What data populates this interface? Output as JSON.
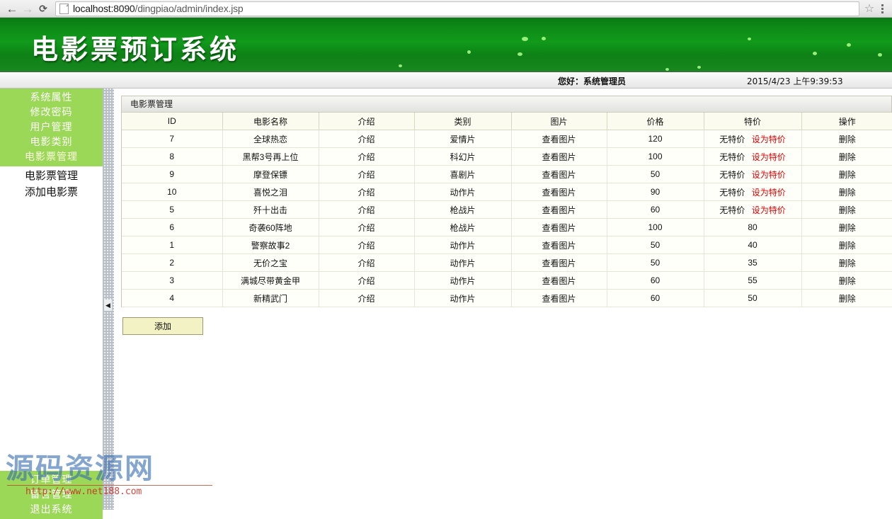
{
  "browser": {
    "back_icon": "back-arrow-icon",
    "forward_icon": "forward-arrow-icon",
    "reload_icon": "reload-icon",
    "url_scheme_host": "localhost:8090",
    "url_path": "/dingpiao/admin/index.jsp",
    "url_full": "localhost:8090/dingpiao/admin/index.jsp",
    "star_glyph": "☆",
    "star_icon": "bookmark-star-icon",
    "menu_icon": "overflow-menu-icon"
  },
  "banner": {
    "title": "电影票预订系统",
    "bg_color": "#0f9419"
  },
  "status": {
    "greeting": "您好：系统管理员",
    "datetime": "2015/4/23 上午9:39:53"
  },
  "sidebar": {
    "group_top": [
      {
        "label": "系统属性"
      },
      {
        "label": "修改密码"
      },
      {
        "label": "用户管理"
      },
      {
        "label": "电影类别"
      },
      {
        "label": "电影票管理"
      }
    ],
    "submenu": [
      {
        "label": "电影票管理"
      },
      {
        "label": "添加电影票"
      }
    ],
    "group_bottom": [
      {
        "label": "订单管理"
      },
      {
        "label": "留言管理"
      },
      {
        "label": "退出系统"
      }
    ],
    "accent_color": "#9cd858",
    "collapse_glyph": "◀"
  },
  "panel": {
    "title": "电影票管理",
    "add_button": "添加"
  },
  "table": {
    "columns": [
      "ID",
      "电影名称",
      "介绍",
      "类别",
      "图片",
      "价格",
      "特价",
      "操作"
    ],
    "intro_label": "介绍",
    "image_label": "查看图片",
    "no_special_label": "无特价",
    "set_special_label": "设为特价",
    "delete_label": "删除",
    "special_link_color": "#e20000",
    "rows": [
      {
        "id": "7",
        "name": "全球热恋",
        "intro": "介绍",
        "category": "爱情片",
        "image": "查看图片",
        "price": "120",
        "special": "无特价",
        "has_special": false,
        "action": "删除"
      },
      {
        "id": "8",
        "name": "黑帮3号再上位",
        "intro": "介绍",
        "category": "科幻片",
        "image": "查看图片",
        "price": "100",
        "special": "无特价",
        "has_special": false,
        "action": "删除"
      },
      {
        "id": "9",
        "name": "摩登保镖",
        "intro": "介绍",
        "category": "喜剧片",
        "image": "查看图片",
        "price": "50",
        "special": "无特价",
        "has_special": false,
        "action": "删除"
      },
      {
        "id": "10",
        "name": "喜悦之泪",
        "intro": "介绍",
        "category": "动作片",
        "image": "查看图片",
        "price": "90",
        "special": "无特价",
        "has_special": false,
        "action": "删除"
      },
      {
        "id": "5",
        "name": "歼十出击",
        "intro": "介绍",
        "category": "枪战片",
        "image": "查看图片",
        "price": "60",
        "special": "无特价",
        "has_special": false,
        "action": "删除"
      },
      {
        "id": "6",
        "name": "奇袭60阵地",
        "intro": "介绍",
        "category": "枪战片",
        "image": "查看图片",
        "price": "100",
        "special": "80",
        "has_special": true,
        "action": "删除"
      },
      {
        "id": "1",
        "name": "警察故事2",
        "intro": "介绍",
        "category": "动作片",
        "image": "查看图片",
        "price": "50",
        "special": "40",
        "has_special": true,
        "action": "删除"
      },
      {
        "id": "2",
        "name": "无价之宝",
        "intro": "介绍",
        "category": "动作片",
        "image": "查看图片",
        "price": "50",
        "special": "35",
        "has_special": true,
        "action": "删除"
      },
      {
        "id": "3",
        "name": "满城尽带黄金甲",
        "intro": "介绍",
        "category": "动作片",
        "image": "查看图片",
        "price": "60",
        "special": "55",
        "has_special": true,
        "action": "删除"
      },
      {
        "id": "4",
        "name": "新精武门",
        "intro": "介绍",
        "category": "动作片",
        "image": "查看图片",
        "price": "60",
        "special": "50",
        "has_special": true,
        "action": "删除"
      }
    ]
  },
  "watermark": {
    "text": "源码资源网",
    "url": "http://www.net188.com"
  }
}
